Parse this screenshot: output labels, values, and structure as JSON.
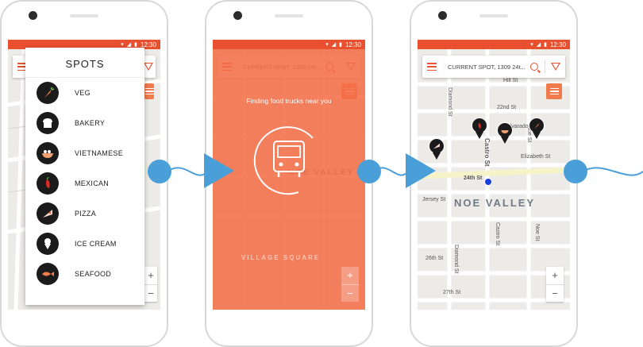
{
  "status": {
    "time": "12:30"
  },
  "search": {
    "text": "CURRENT SPOT, 1309 24t..."
  },
  "spots_panel": {
    "title": "SPOTS",
    "items": [
      {
        "label": "VEG",
        "icon": "carrot-icon"
      },
      {
        "label": "BAKERY",
        "icon": "bread-icon"
      },
      {
        "label": "VIETNAMESE",
        "icon": "noodle-bowl-icon"
      },
      {
        "label": "MEXICAN",
        "icon": "chili-pepper-icon"
      },
      {
        "label": "PIZZA",
        "icon": "pizza-slice-icon"
      },
      {
        "label": "ICE CREAM",
        "icon": "ice-cream-icon"
      },
      {
        "label": "SEAFOOD",
        "icon": "fish-icon"
      }
    ]
  },
  "loading": {
    "message": "Finding food trucks near you"
  },
  "map": {
    "neighborhood": "NOE VALLEY",
    "area_label": "VILLAGE SQUARE",
    "streets": [
      "Hill St",
      "22nd St",
      "Alvarado St",
      "Elizabeth St",
      "24th St",
      "Jersey St",
      "26th St",
      "27th St",
      "Diamond St",
      "Castro St",
      "Noe St",
      "Castro St",
      "Noe St",
      "Diamond St"
    ]
  },
  "zoom": {
    "plus": "+",
    "minus": "−"
  },
  "colors": {
    "accent": "#e8502f",
    "overlay": "#f36e48",
    "flow": "#4a9fd8"
  }
}
